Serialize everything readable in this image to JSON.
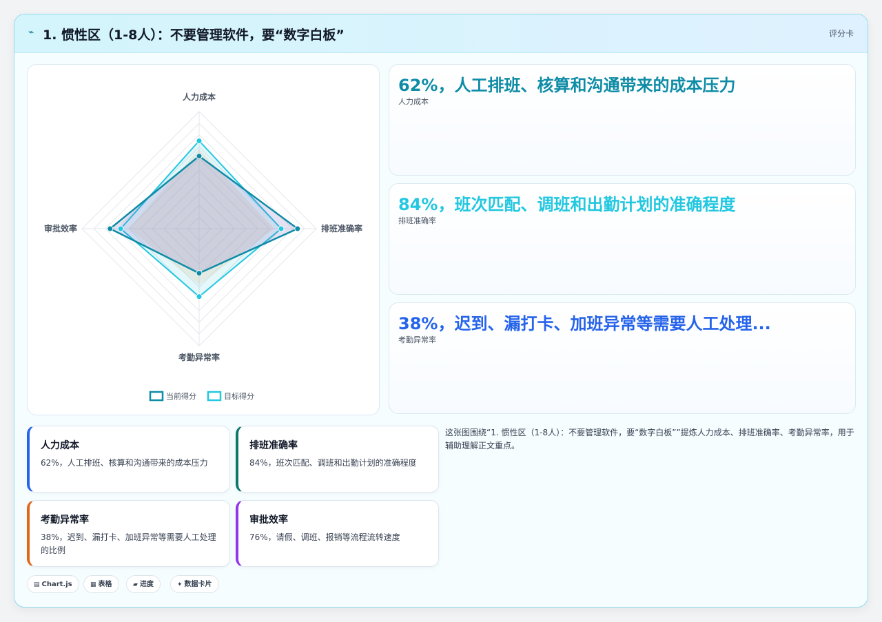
{
  "header": {
    "icon": "⌁",
    "title": "1. 惯性区（1-8人）：不要管理软件，要“数字白板”",
    "badge": "评分卡"
  },
  "stats": [
    {
      "headline": "62%，人工排班、核算和沟通带来的成本压力",
      "label": "人力成本",
      "color": "#0e8ca6"
    },
    {
      "headline": "84%，班次匹配、调班和出勤计划的准确程度",
      "label": "排班准确率",
      "color": "#22c7e0"
    },
    {
      "headline": "38%，迟到、漏打卡、加班异常等需要人工处理...",
      "label": "考勤异常率",
      "color": "#2563eb"
    }
  ],
  "metrics": [
    {
      "name": "人力成本",
      "desc": "62%，人工排班、核算和沟通带来的成本压力",
      "accent": "#2563eb"
    },
    {
      "name": "排班准确率",
      "desc": "84%，班次匹配、调班和出勤计划的准确程度",
      "accent": "#0f766e"
    },
    {
      "name": "考勤异常率",
      "desc": "38%，迟到、漏打卡、加班异常等需要人工处理的比例",
      "accent": "#e2661a"
    },
    {
      "name": "审批效率",
      "desc": "76%，请假、调班、报销等流程流转速度",
      "accent": "#9333ea"
    }
  ],
  "note": "这张图围绕“1. 惯性区（1-8人）：不要管理软件，要“数字白板””提炼人力成本、排班准确率、考勤异常率，用于辅助理解正文重点。",
  "tags": [
    {
      "icon": "▤",
      "label": "Chart.js"
    },
    {
      "icon": "▦",
      "label": "表格"
    },
    {
      "icon": "▰",
      "label": "进度"
    },
    {
      "icon": "✦",
      "label": "数据卡片"
    }
  ],
  "chart_data": {
    "type": "radar",
    "categories": [
      "人力成本",
      "排班准确率",
      "考勤异常率",
      "审批效率"
    ],
    "series": [
      {
        "name": "当前得分",
        "values": [
          62,
          84,
          38,
          76
        ],
        "color": "#0e8ca6"
      },
      {
        "name": "目标得分",
        "values": [
          75,
          70,
          58,
          67
        ],
        "color": "#22c7e0"
      }
    ],
    "extra_fill": {
      "values": [
        68,
        64,
        48,
        60
      ],
      "color": "#f7c9a8"
    },
    "rlim": [
      0,
      100
    ],
    "grid_rings": 10,
    "legend_position": "bottom"
  }
}
